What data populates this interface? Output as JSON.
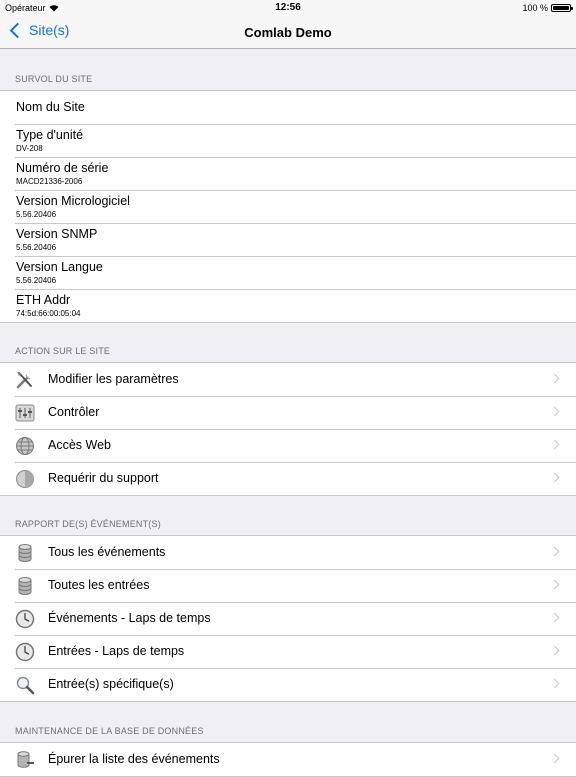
{
  "status_bar": {
    "carrier": "Opérateur",
    "time": "12:56",
    "battery": "100 %"
  },
  "nav": {
    "back_label": "Site(s)",
    "title": "Comlab Demo"
  },
  "colors": {
    "accent": "#1a6fe0",
    "background": "#efeff4",
    "separator": "#c8c7cc"
  },
  "site_info": {
    "header": "SURVOL DU SITE",
    "rows": [
      {
        "title": "Nom du Site",
        "value": ""
      },
      {
        "title": "Type d'unité",
        "value": "DV-208"
      },
      {
        "title": "Numéro de série",
        "value": "MACD21336-2006"
      },
      {
        "title": "Version Micrologiciel",
        "value": "5.56.20406"
      },
      {
        "title": "Version SNMP",
        "value": "5.56.20406"
      },
      {
        "title": "Version Langue",
        "value": "5.56.20406"
      },
      {
        "title": "ETH Addr",
        "value": "74:5d:66:00:05:04"
      }
    ]
  },
  "site_actions": {
    "header": "ACTION SUR LE SITE",
    "rows": [
      {
        "label": "Modifier les paramètres",
        "icon": "tools-icon"
      },
      {
        "label": "Contrôler",
        "icon": "control-panel-icon"
      },
      {
        "label": "Accès Web",
        "icon": "globe-icon"
      },
      {
        "label": "Requérir du support",
        "icon": "support-icon"
      }
    ]
  },
  "event_reports": {
    "header": "RAPPORT DE(S) ÉVÉNEMENT(S)",
    "rows": [
      {
        "label": "Tous les événements",
        "icon": "database-icon"
      },
      {
        "label": "Toutes les entrées",
        "icon": "database-icon"
      },
      {
        "label": "Événements - Laps de temps",
        "icon": "clock-icon"
      },
      {
        "label": "Entrées - Laps de temps",
        "icon": "clock-icon"
      },
      {
        "label": "Entrée(s) spécifique(s)",
        "icon": "magnifier-icon"
      }
    ]
  },
  "db_maintenance": {
    "header": "MAINTENANCE DE LA BASE DE DONNÉES",
    "rows": [
      {
        "label": "Épurer la liste des événements",
        "icon": "database-purge-icon"
      }
    ]
  }
}
